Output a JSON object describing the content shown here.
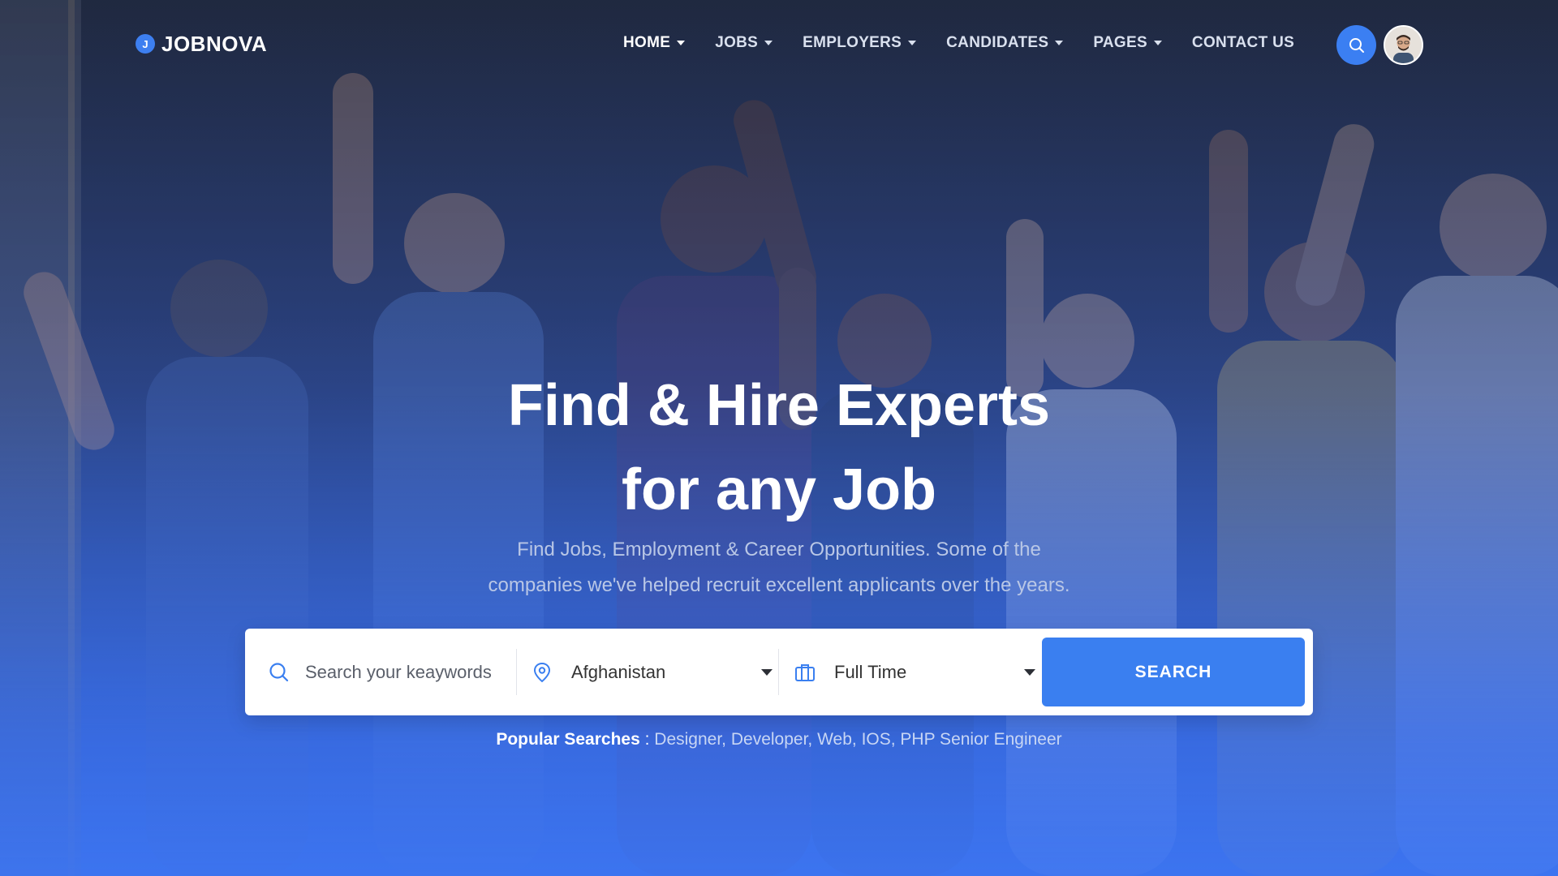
{
  "brand": {
    "logo_letter": "J",
    "name": "JOBNOVA",
    "accent_color": "#3a7ff0"
  },
  "nav": {
    "items": [
      {
        "label": "HOME",
        "has_dropdown": true,
        "active": true
      },
      {
        "label": "JOBS",
        "has_dropdown": true,
        "active": false
      },
      {
        "label": "EMPLOYERS",
        "has_dropdown": true,
        "active": false
      },
      {
        "label": "CANDIDATES",
        "has_dropdown": true,
        "active": false
      },
      {
        "label": "PAGES",
        "has_dropdown": true,
        "active": false
      },
      {
        "label": "CONTACT US",
        "has_dropdown": false,
        "active": false
      }
    ],
    "search_icon": "search-icon",
    "avatar_icon": "user-avatar"
  },
  "hero": {
    "title_line1": "Find & Hire Experts",
    "title_line2": "for any Job",
    "subtitle_line1": "Find Jobs, Employment & Career Opportunities. Some of the",
    "subtitle_line2": "companies we've helped recruit excellent applicants over the years."
  },
  "search": {
    "keyword_placeholder": "Search your keaywords",
    "keyword_value": "",
    "location_selected": "Afghanistan",
    "job_type_selected": "Full Time",
    "button_label": "SEARCH",
    "keyword_icon": "search-icon",
    "location_icon": "map-pin-icon",
    "type_icon": "briefcase-icon"
  },
  "popular": {
    "label": "Popular Searches",
    "separator": " : ",
    "tags": [
      "Designer",
      "Developer",
      "Web",
      "IOS",
      "PHP Senior Engineer"
    ]
  }
}
